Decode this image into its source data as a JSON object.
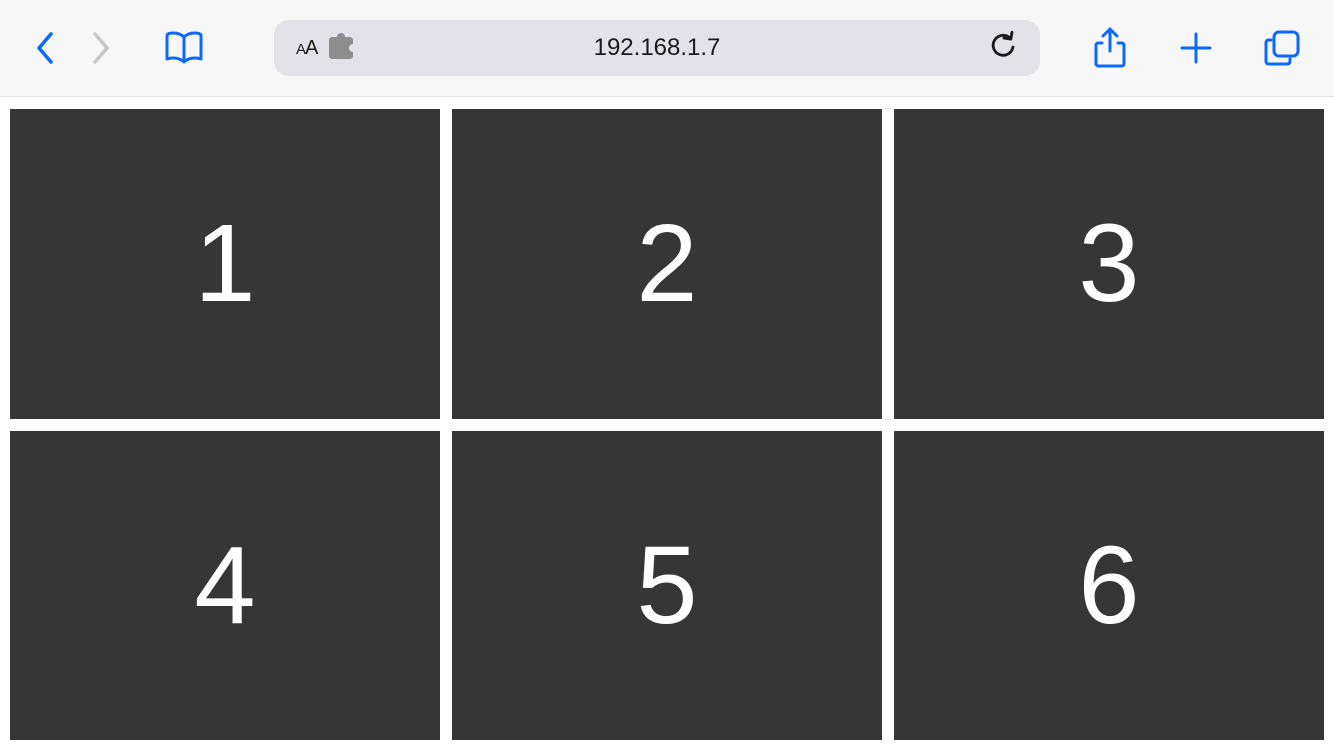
{
  "toolbar": {
    "text_size_label": "aA",
    "url": "192.168.1.7"
  },
  "colors": {
    "accent": "#0b69ff",
    "disabled": "#c7c7c9",
    "tile_bg": "#363636",
    "toolbar_bg": "#f7f7f8",
    "address_bg": "#e3e2e8"
  },
  "grid": {
    "tiles": [
      "1",
      "2",
      "3",
      "4",
      "5",
      "6"
    ]
  }
}
